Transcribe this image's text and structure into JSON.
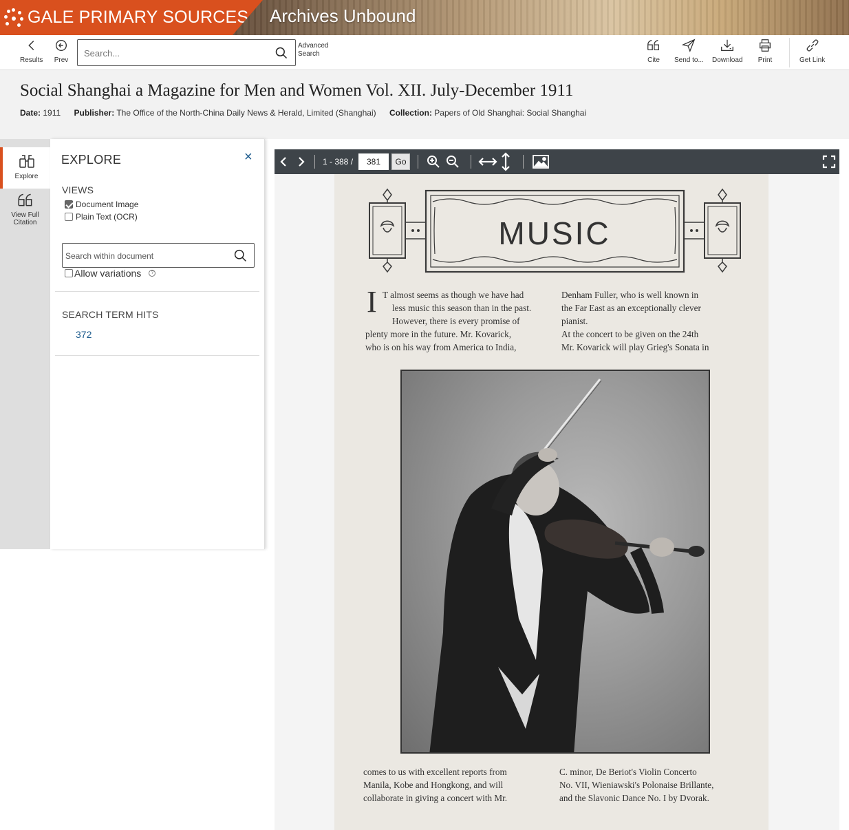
{
  "banner": {
    "brand": "GALE PRIMARY SOURCES",
    "product": "Archives Unbound"
  },
  "toolbar": {
    "results_label": "Results",
    "prev_label": "Prev",
    "search_placeholder": "Search...",
    "advanced_line1": "Advanced",
    "advanced_line2": "Search",
    "cite_label": "Cite",
    "send_label": "Send to...",
    "download_label": "Download",
    "print_label": "Print",
    "getlink_label": "Get Link"
  },
  "document": {
    "title": "Social Shanghai a Magazine for Men and Women Vol. XII. July-December 1911",
    "date_label": "Date:",
    "date": "1911",
    "publisher_label": "Publisher:",
    "publisher": "The Office of the North-China Daily News & Herald, Limited (Shanghai)",
    "collection_label": "Collection:",
    "collection": "Papers of Old Shanghai: Social Shanghai"
  },
  "rail": {
    "explore_label": "Explore",
    "citation_line1": "View Full",
    "citation_line2": "Citation"
  },
  "explore": {
    "title": "EXPLORE",
    "close": "×",
    "views_heading": "VIEWS",
    "views": [
      {
        "label": "Document Image",
        "checked": true
      },
      {
        "label": "Plain Text (OCR)",
        "checked": false
      }
    ],
    "search_placeholder": "Search within document",
    "allow_variations": "Allow variations",
    "help": "?",
    "hits_heading": "SEARCH TERM HITS",
    "hits_count": "372"
  },
  "viewer": {
    "page_range": "1 - 388 /",
    "page_value": "381",
    "go_label": "Go"
  },
  "page": {
    "heading": "MUSIC",
    "dropcap": "I",
    "col1_top": [
      "T almost seems as though we have had",
      "less music this season than in the past.",
      "However, there is every promise of",
      "plenty more in the future.   Mr. Kovarick,",
      "who is on his way from America to India,"
    ],
    "col2_top": [
      "Denham  Fuller,  who  is  well  known  in",
      "the  Far  East  as  an  exceptionally  clever",
      "pianist.",
      "   At  the  concert  to  be  given  on  the  24th",
      "Mr.  Kovarick  will  play  Grieg's  Sonata  in"
    ],
    "col1_bottom": [
      "comes  to  us  with  excellent  reports  from",
      "Manila,  Kobe  and  Hongkong,  and  will",
      "collaborate  in  giving  a  concert  with  Mr."
    ],
    "col2_bottom": [
      "C.  minor,  De  Beriot's  Violin  Concerto",
      "No. VII, Wieniawski's Polonaise Brillante,",
      "and  the  Slavonic  Dance  No.  I  by  Dvorak."
    ]
  },
  "colors": {
    "brand_orange": "#d9501e",
    "link_blue": "#1b5a8c",
    "viewer_bar": "#3e4449"
  }
}
